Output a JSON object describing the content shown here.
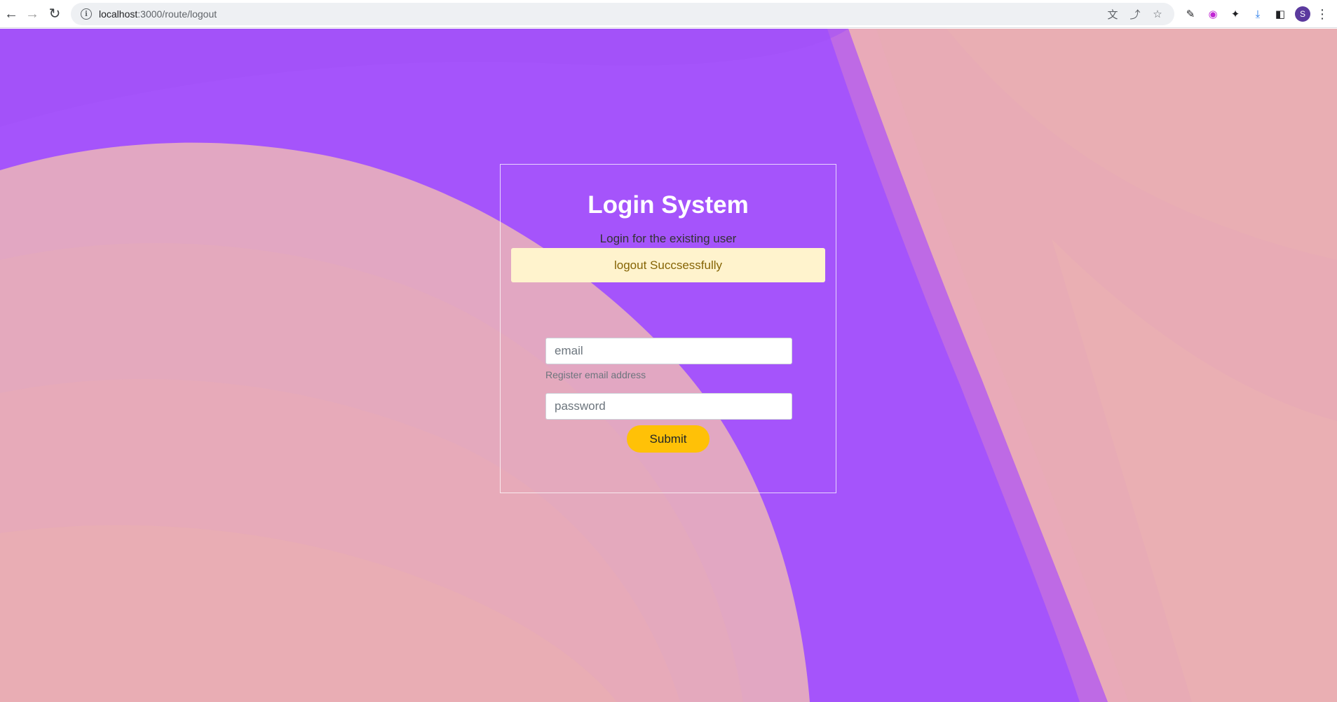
{
  "browser": {
    "url_host": "localhost",
    "url_path": ":3000/route/logout",
    "avatar_letter": "S"
  },
  "login": {
    "title": "Login System",
    "subtitle": "Login for the existing user",
    "alert_message": "logout Succsessfully",
    "email_placeholder": "email",
    "email_help": "Register email address",
    "password_placeholder": "password",
    "submit_label": "Submit"
  },
  "colors": {
    "background_purple": "#a554fb",
    "background_pink": "#e6a8b8",
    "alert_bg": "#fff3cd",
    "submit_bg": "#ffc107"
  },
  "icons": {
    "back": "arrow-left-icon",
    "forward": "arrow-right-icon",
    "reload": "reload-icon",
    "site_info": "info-icon",
    "translate": "translate-icon",
    "share": "share-icon",
    "bookmark": "star-icon",
    "eyedropper": "eyedropper-icon",
    "extension_color": "color-extension-icon",
    "extensions": "puzzle-icon",
    "downloads": "download-icon",
    "side_panel": "side-panel-icon",
    "menu": "kebab-menu-icon"
  }
}
